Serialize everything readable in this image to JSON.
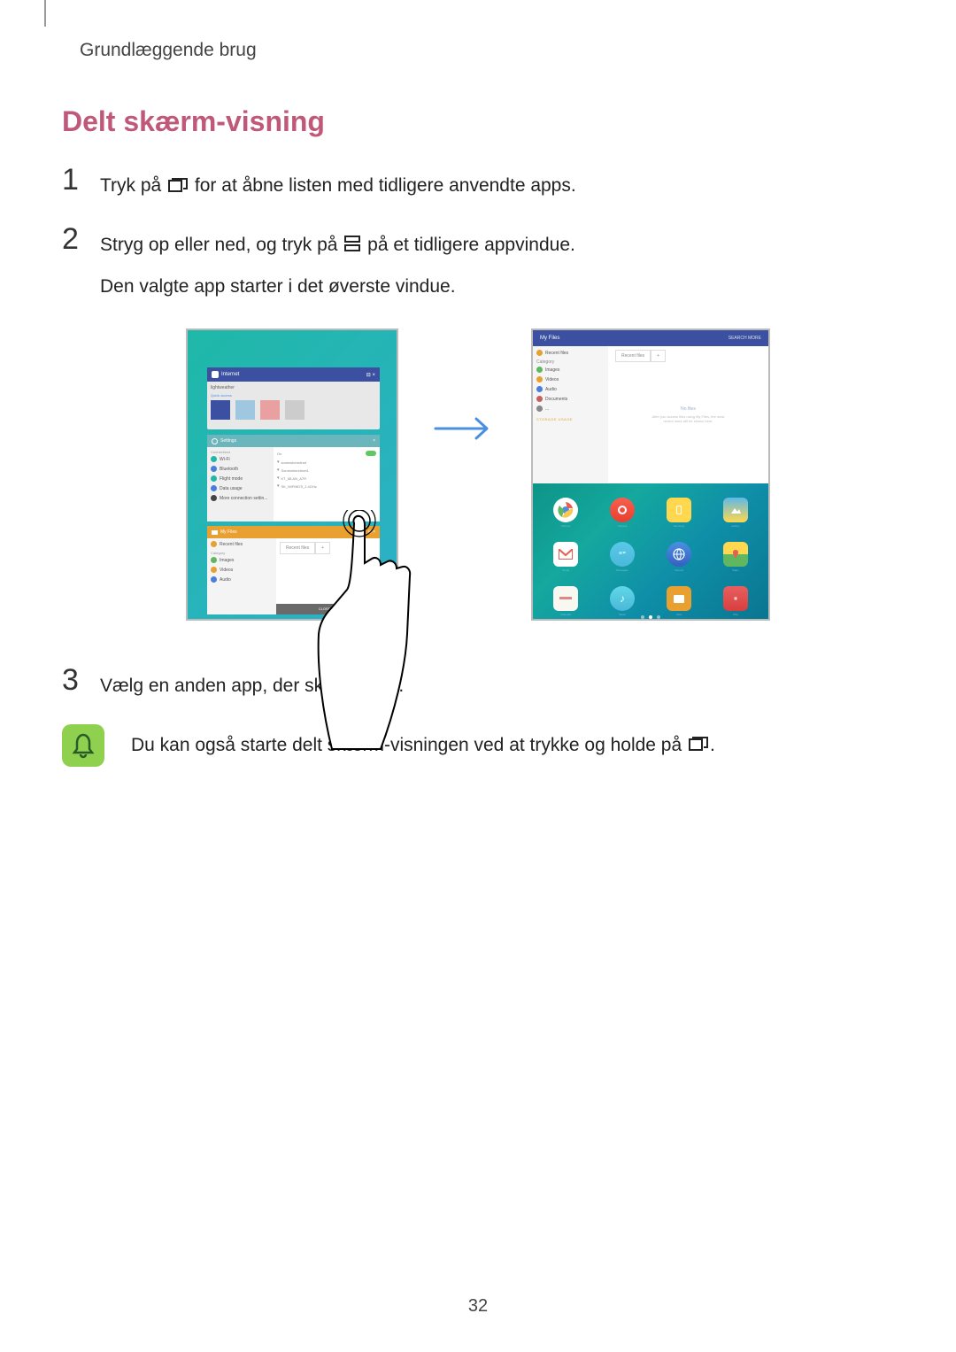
{
  "breadcrumb": "Grundlæggende brug",
  "section_title": "Delt skærm-visning",
  "steps": {
    "s1": {
      "num": "1",
      "text_before": "Tryk på ",
      "text_after": " for at åbne listen med tidligere anvendte apps."
    },
    "s2": {
      "num": "2",
      "text_before": "Stryg op eller ned, og tryk på ",
      "text_after": " på et tidligere appvindue.",
      "line2": "Den valgte app starter i det øverste vindue."
    },
    "s3": {
      "num": "3",
      "text": "Vælg en anden app, der skal startes."
    }
  },
  "note": {
    "text_before": "Du kan også starte delt skærm-visningen ved at trykke og holde på ",
    "text_after": "."
  },
  "page_number": "32",
  "left_screenshot": {
    "panel_top": {
      "title": "Internet",
      "address": "lightweather",
      "thumbs": [
        "",
        "",
        "",
        ""
      ]
    },
    "panel_mid": {
      "title": "Settings",
      "section": "Connections",
      "items": [
        "Wi-Fi",
        "Bluetooth",
        "Flight mode",
        "Data usage",
        "More connection settin..."
      ],
      "right_lines": [
        "On",
        "somewhere#net",
        "Somewhere#net1",
        "KT_MLAN_A7R",
        "SK_WiFi9875_2.4GHz"
      ]
    },
    "panel_bottom": {
      "title": "My Files",
      "items": [
        "Recent files",
        "Images",
        "Videos",
        "Audio"
      ],
      "category_label": "Category",
      "tab": "Recent files",
      "footer": "CLOSE ALL"
    }
  },
  "right_screenshot": {
    "header": "My Files",
    "header_actions": "SEARCH   MORE",
    "sidebar": {
      "items": [
        "Recent files",
        "Images",
        "Videos",
        "Audio",
        "Documents"
      ],
      "category_label": "Category",
      "storage_label": "STORAGE USAGE"
    },
    "content": {
      "tab": "Recent files",
      "plus": "+",
      "no_files_title": "No files",
      "no_files_sub": "After you access files using My Files, the most recent ones will be shown here."
    },
    "apps": {
      "row1": [
        "Chrome",
        "Camera",
        "Samsung",
        "Gallery"
      ],
      "row2": [
        "Gmail",
        "Messages",
        "Internet",
        "Maps"
      ],
      "row3": [
        "Calendar",
        "Music",
        "Files",
        "Play"
      ]
    }
  }
}
